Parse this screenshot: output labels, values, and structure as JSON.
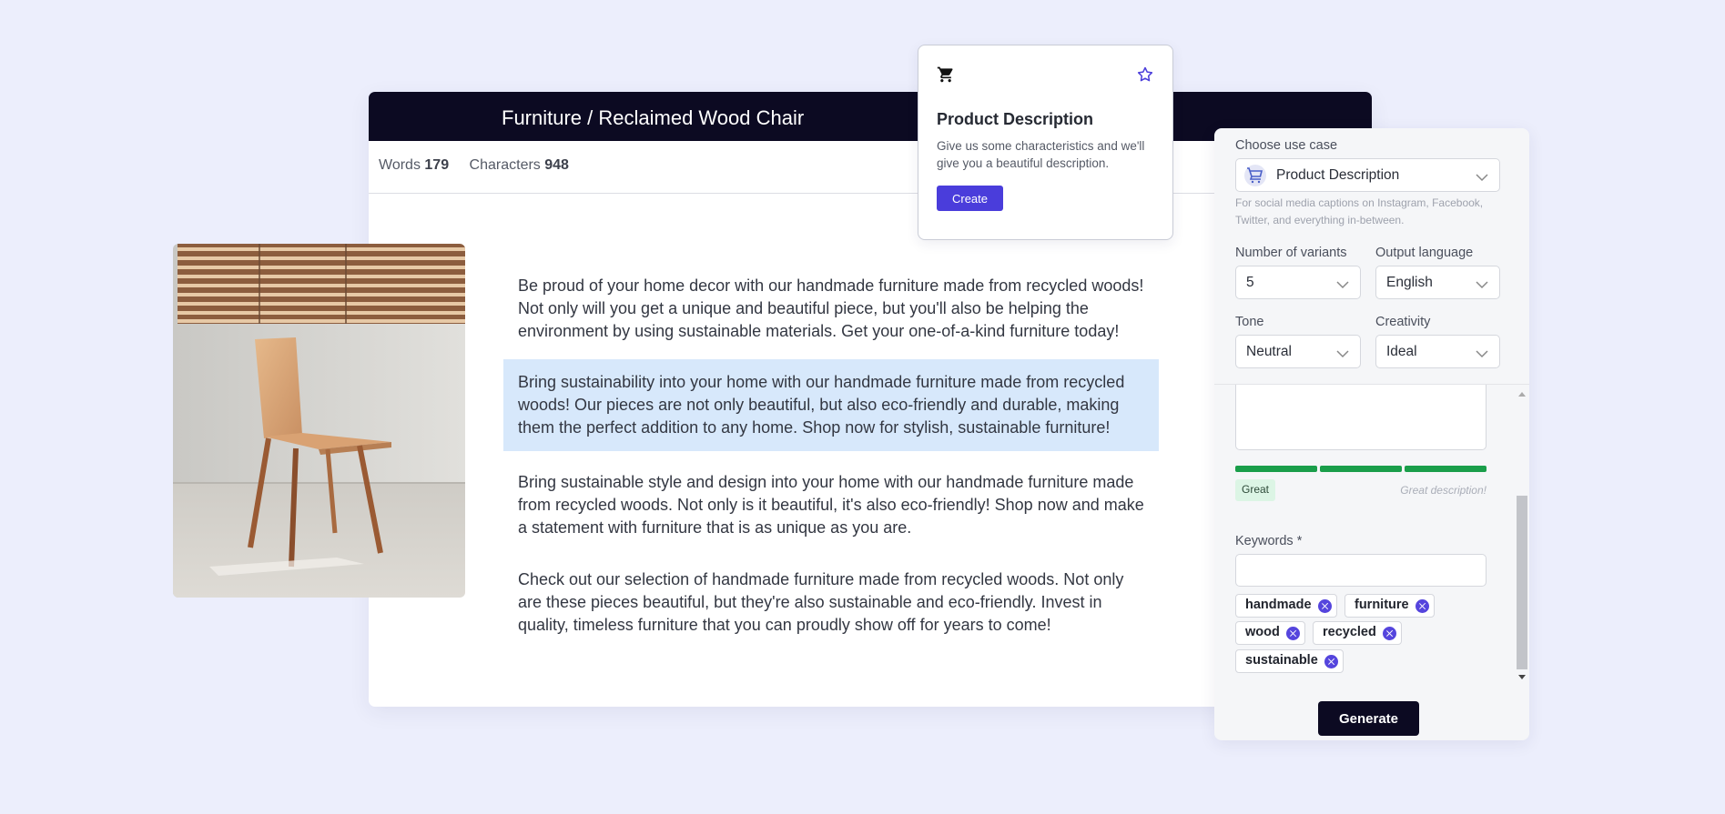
{
  "editor": {
    "breadcrumb": "Furniture / Reclaimed Wood Chair",
    "stats": {
      "words_label": "Words",
      "words_value": "179",
      "characters_label": "Characters",
      "characters_value": "948"
    },
    "paragraphs": [
      "Be proud of your home decor with our handmade furniture made from recycled woods! Not only will you get a unique and beautiful piece, but you'll also be helping the environment by using sustainable materials. Get your one-of-a-kind furniture today!",
      "Bring sustainability into your home with our handmade furniture made from recycled woods! Our pieces are not only beautiful, but also eco-friendly and durable, making them the perfect addition to any home. Shop now for stylish, sustainable furniture!",
      "Bring sustainable style and design into your home with our handmade furniture made from recycled woods. Not only is it beautiful, it's also eco-friendly! Shop now and make a statement with furniture that is as unique as you are.",
      "Check out our selection of handmade furniture made from recycled woods. Not only are these pieces beautiful, but they're also sustainable and eco-friendly. Invest in quality, timeless furniture that you can proudly show off for years to come!"
    ]
  },
  "product_card": {
    "icon": "shopping-cart-icon",
    "favorite_icon": "star-icon",
    "title": "Product Description",
    "description": "Give us some characteristics and we'll give you a beautiful description.",
    "create_label": "Create"
  },
  "panel": {
    "use_case_label": "Choose use case",
    "use_case_value": "Product Description",
    "use_case_hint": "For social media captions on Instagram, Facebook, Twitter, and everything in-between.",
    "variants_label": "Number of variants",
    "variants_value": "5",
    "language_label": "Output language",
    "language_value": "English",
    "tone_label": "Tone",
    "tone_value": "Neutral",
    "creativity_label": "Creativity",
    "creativity_value": "Ideal",
    "quality_badge": "Great",
    "quality_text": "Great description!",
    "keywords_label": "Keywords *",
    "keywords": [
      "handmade",
      "furniture",
      "wood",
      "recycled",
      "sustainable"
    ],
    "generate_label": "Generate"
  },
  "colors": {
    "accent": "#4a3ddb",
    "dark": "#0c0a22",
    "highlight": "#d7e8fb",
    "success": "#1a9e4a"
  }
}
